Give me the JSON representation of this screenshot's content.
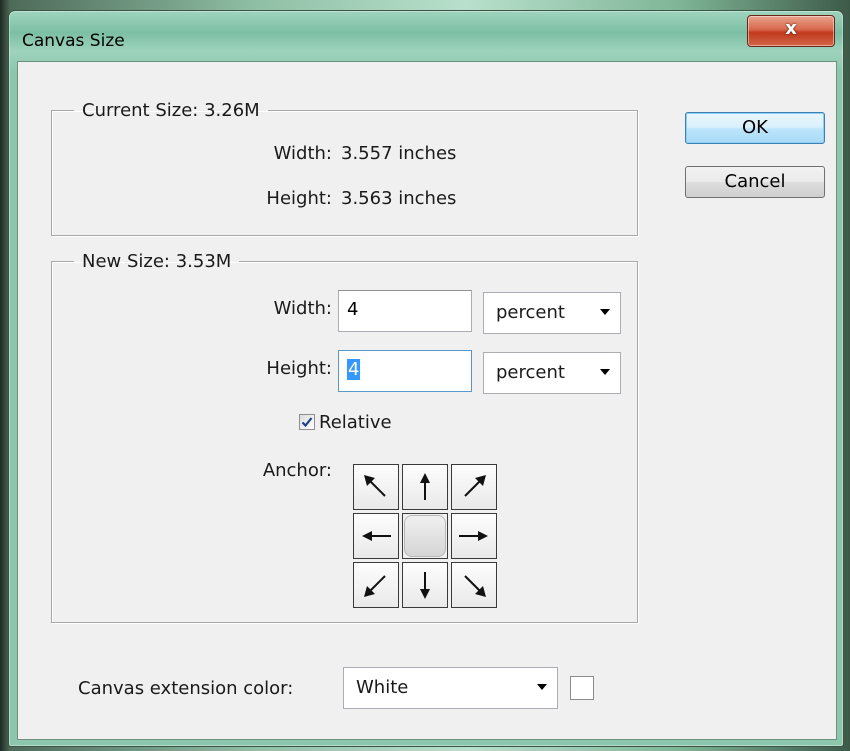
{
  "window": {
    "title": "Canvas Size",
    "close_label": "x"
  },
  "current_size": {
    "legend": "Current Size: 3.26M",
    "width_label": "Width:",
    "width_value": "3.557 inches",
    "height_label": "Height:",
    "height_value": "3.563 inches"
  },
  "new_size": {
    "legend": "New Size: 3.53M",
    "width_label": "Width:",
    "width_value": "4",
    "width_unit": "percent",
    "height_label": "Height:",
    "height_value": "4",
    "height_unit": "percent",
    "relative_label": "Relative",
    "relative_checked": true,
    "anchor_label": "Anchor:"
  },
  "anchor": {
    "cells": [
      "arrow-up-left-icon",
      "arrow-up-icon",
      "arrow-up-right-icon",
      "arrow-left-icon",
      "anchor-center",
      "arrow-right-icon",
      "arrow-down-left-icon",
      "arrow-down-icon",
      "arrow-down-right-icon"
    ]
  },
  "extension": {
    "label": "Canvas extension color:",
    "value": "White",
    "swatch_color": "#ffffff"
  },
  "buttons": {
    "ok": "OK",
    "cancel": "Cancel"
  }
}
